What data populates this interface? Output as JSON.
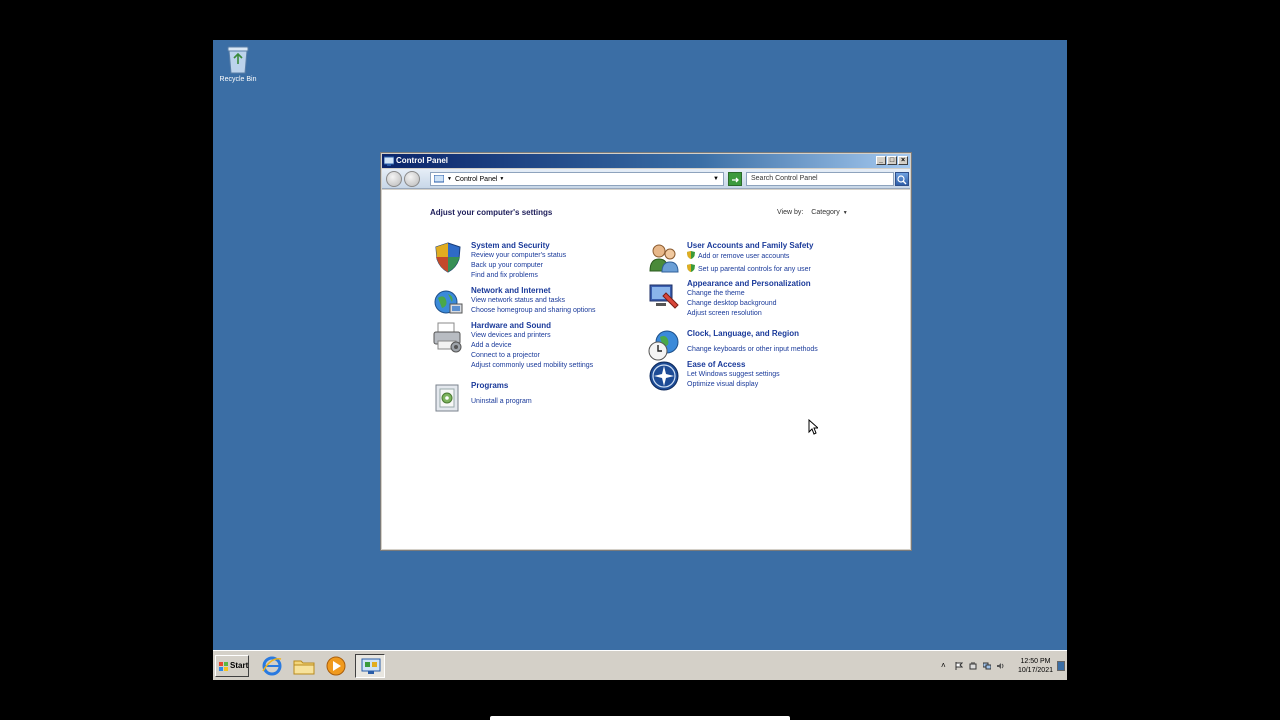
{
  "desktop": {
    "recycle_bin_label": "Recycle Bin",
    "background_color": "#3b6ea5"
  },
  "window": {
    "title": "Control Panel",
    "address_crumb": "Control Panel",
    "search_placeholder": "Search Control Panel",
    "heading": "Adjust your computer's settings",
    "view_by_label": "View by:",
    "view_by_value": "Category"
  },
  "categories_left": [
    {
      "icon": "shield-icon",
      "title": "System and Security",
      "links": [
        "Review your computer's status",
        "Back up your computer",
        "Find and fix problems"
      ]
    },
    {
      "icon": "network-globe-icon",
      "title": "Network and Internet",
      "links": [
        "View network status and tasks",
        "Choose homegroup and sharing options"
      ]
    },
    {
      "icon": "printer-icon",
      "title": "Hardware and Sound",
      "links": [
        "View devices and printers",
        "Add a device",
        "Connect to a projector",
        "Adjust commonly used mobility settings"
      ]
    },
    {
      "icon": "programs-icon",
      "title": "Programs",
      "links": [
        "Uninstall a program"
      ]
    }
  ],
  "categories_right": [
    {
      "icon": "users-icon",
      "title": "User Accounts and Family Safety",
      "links": [
        "Add or remove user accounts",
        "Set up parental controls for any user"
      ]
    },
    {
      "icon": "appearance-icon",
      "title": "Appearance and Personalization",
      "links": [
        "Change the theme",
        "Change desktop background",
        "Adjust screen resolution"
      ]
    },
    {
      "icon": "clock-globe-icon",
      "title": "Clock, Language, and Region",
      "links": [
        "Change keyboards or other input methods"
      ]
    },
    {
      "icon": "ease-of-access-icon",
      "title": "Ease of Access",
      "links": [
        "Let Windows suggest settings",
        "Optimize visual display"
      ]
    }
  ],
  "taskbar": {
    "start_label": "Start",
    "pinned": [
      "internet-explorer-icon",
      "explorer-folder-icon",
      "media-player-icon",
      "control-panel-icon"
    ],
    "clock_time": "12:50 PM",
    "clock_date": "10/17/2021"
  }
}
